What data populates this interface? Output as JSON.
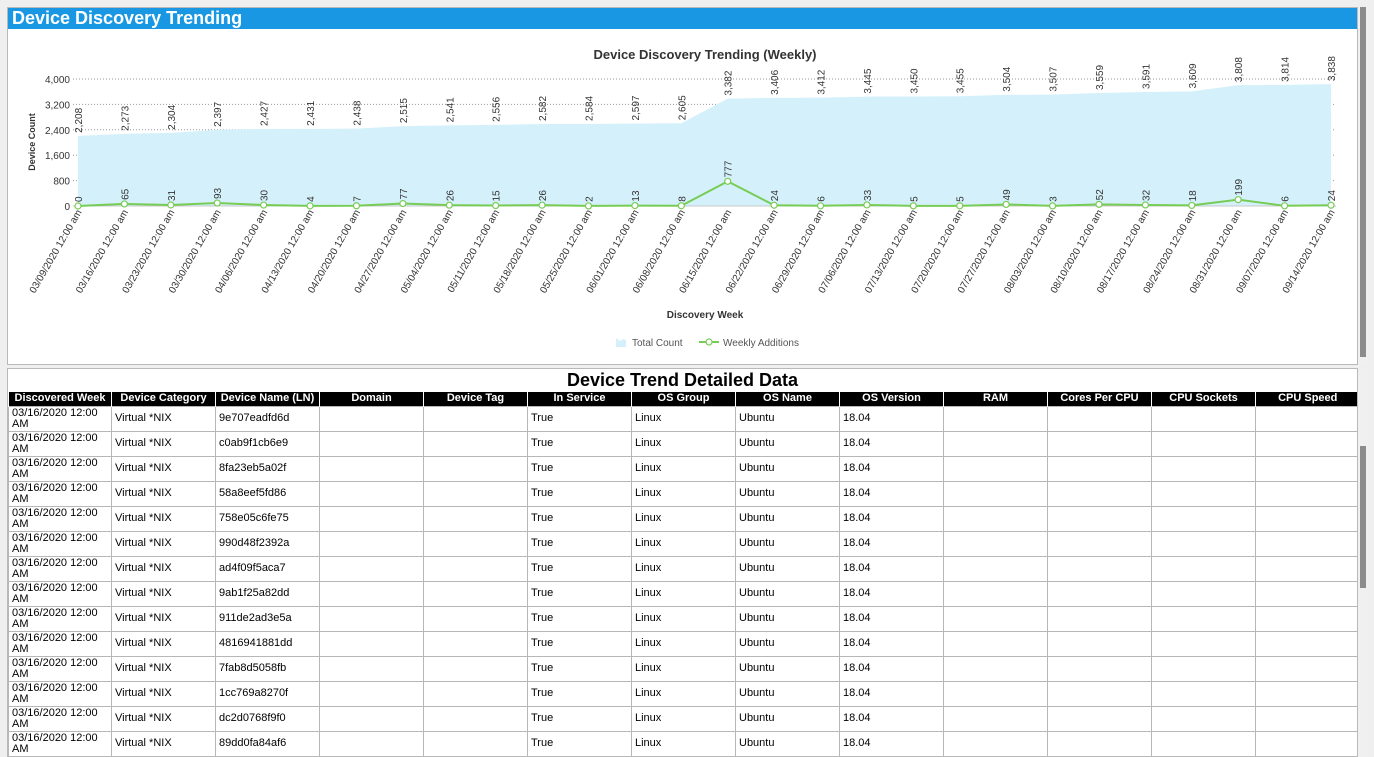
{
  "header": {
    "title": "Device Discovery Trending"
  },
  "chart_data": {
    "type": "area",
    "title": "Device Discovery Trending (Weekly)",
    "xlabel": "Discovery Week",
    "ylabel": "Device Count",
    "ylim": [
      0,
      4000
    ],
    "yticks": [
      "0",
      "800",
      "1,600",
      "2,400",
      "3,200",
      "4,000"
    ],
    "grid": "horizontal dotted",
    "legend_placement": "bottom-center",
    "categories": [
      "03/09/2020 12:00 am",
      "03/16/2020 12:00 am",
      "03/23/2020 12:00 am",
      "03/30/2020 12:00 am",
      "04/06/2020 12:00 am",
      "04/13/2020 12:00 am",
      "04/20/2020 12:00 am",
      "04/27/2020 12:00 am",
      "05/04/2020 12:00 am",
      "05/11/2020 12:00 am",
      "05/18/2020 12:00 am",
      "05/25/2020 12:00 am",
      "06/01/2020 12:00 am",
      "06/08/2020 12:00 am",
      "06/15/2020 12:00 am",
      "06/22/2020 12:00 am",
      "06/29/2020 12:00 am",
      "07/06/2020 12:00 am",
      "07/13/2020 12:00 am",
      "07/20/2020 12:00 am",
      "07/27/2020 12:00 am",
      "08/03/2020 12:00 am",
      "08/10/2020 12:00 am",
      "08/17/2020 12:00 am",
      "08/24/2020 12:00 am",
      "08/31/2020 12:00 am",
      "09/07/2020 12:00 am",
      "09/14/2020 12:00 am"
    ],
    "series": [
      {
        "name": "Total Count",
        "type": "area",
        "color": "#d4f1fb",
        "values": [
          2208,
          2273,
          2304,
          2397,
          2427,
          2431,
          2438,
          2515,
          2541,
          2556,
          2582,
          2584,
          2597,
          2605,
          3382,
          3406,
          3412,
          3445,
          3450,
          3455,
          3504,
          3507,
          3559,
          3591,
          3609,
          3808,
          3814,
          3838
        ],
        "labels": [
          "2,208",
          "2,273",
          "2,304",
          "2,397",
          "2,427",
          "2,431",
          "2,438",
          "2,515",
          "2,541",
          "2,556",
          "2,582",
          "2,584",
          "2,597",
          "2,605",
          "3,382",
          "3,406",
          "3,412",
          "3,445",
          "3,450",
          "3,455",
          "3,504",
          "3,507",
          "3,559",
          "3,591",
          "3,609",
          "3,808",
          "3,814",
          "3,838"
        ]
      },
      {
        "name": "Weekly Additions",
        "type": "line",
        "color": "#77cc55",
        "values": [
          0,
          65,
          31,
          93,
          30,
          4,
          7,
          77,
          26,
          15,
          26,
          2,
          13,
          8,
          777,
          24,
          6,
          33,
          5,
          5,
          49,
          3,
          52,
          32,
          18,
          199,
          6,
          24
        ],
        "labels": [
          "0",
          "65",
          "31",
          "93",
          "30",
          "4",
          "7",
          "77",
          "26",
          "15",
          "26",
          "2",
          "13",
          "8",
          "777",
          "24",
          "6",
          "33",
          "5",
          "5",
          "49",
          "3",
          "52",
          "32",
          "18",
          "199",
          "6",
          "24"
        ]
      }
    ]
  },
  "table": {
    "title": "Device Trend Detailed Data",
    "columns": [
      "Discovered Week",
      "Device Category",
      "Device Name (LN)",
      "Domain",
      "Device Tag",
      "In Service",
      "OS Group",
      "OS Name",
      "OS Version",
      "RAM",
      "Cores Per CPU",
      "CPU Sockets",
      "CPU Speed"
    ],
    "rows": [
      [
        "03/16/2020 12:00 AM",
        "Virtual *NIX",
        "9e707eadfd6d",
        "",
        "",
        "True",
        "Linux",
        "Ubuntu",
        "18.04",
        "",
        "",
        "",
        ""
      ],
      [
        "03/16/2020 12:00 AM",
        "Virtual *NIX",
        "c0ab9f1cb6e9",
        "",
        "",
        "True",
        "Linux",
        "Ubuntu",
        "18.04",
        "",
        "",
        "",
        ""
      ],
      [
        "03/16/2020 12:00 AM",
        "Virtual *NIX",
        "8fa23eb5a02f",
        "",
        "",
        "True",
        "Linux",
        "Ubuntu",
        "18.04",
        "",
        "",
        "",
        ""
      ],
      [
        "03/16/2020 12:00 AM",
        "Virtual *NIX",
        "58a8eef5fd86",
        "",
        "",
        "True",
        "Linux",
        "Ubuntu",
        "18.04",
        "",
        "",
        "",
        ""
      ],
      [
        "03/16/2020 12:00 AM",
        "Virtual *NIX",
        "758e05c6fe75",
        "",
        "",
        "True",
        "Linux",
        "Ubuntu",
        "18.04",
        "",
        "",
        "",
        ""
      ],
      [
        "03/16/2020 12:00 AM",
        "Virtual *NIX",
        "990d48f2392a",
        "",
        "",
        "True",
        "Linux",
        "Ubuntu",
        "18.04",
        "",
        "",
        "",
        ""
      ],
      [
        "03/16/2020 12:00 AM",
        "Virtual *NIX",
        "ad4f09f5aca7",
        "",
        "",
        "True",
        "Linux",
        "Ubuntu",
        "18.04",
        "",
        "",
        "",
        ""
      ],
      [
        "03/16/2020 12:00 AM",
        "Virtual *NIX",
        "9ab1f25a82dd",
        "",
        "",
        "True",
        "Linux",
        "Ubuntu",
        "18.04",
        "",
        "",
        "",
        ""
      ],
      [
        "03/16/2020 12:00 AM",
        "Virtual *NIX",
        "911de2ad3e5a",
        "",
        "",
        "True",
        "Linux",
        "Ubuntu",
        "18.04",
        "",
        "",
        "",
        ""
      ],
      [
        "03/16/2020 12:00 AM",
        "Virtual *NIX",
        "4816941881dd",
        "",
        "",
        "True",
        "Linux",
        "Ubuntu",
        "18.04",
        "",
        "",
        "",
        ""
      ],
      [
        "03/16/2020 12:00 AM",
        "Virtual *NIX",
        "7fab8d5058fb",
        "",
        "",
        "True",
        "Linux",
        "Ubuntu",
        "18.04",
        "",
        "",
        "",
        ""
      ],
      [
        "03/16/2020 12:00 AM",
        "Virtual *NIX",
        "1cc769a8270f",
        "",
        "",
        "True",
        "Linux",
        "Ubuntu",
        "18.04",
        "",
        "",
        "",
        ""
      ],
      [
        "03/16/2020 12:00 AM",
        "Virtual *NIX",
        "dc2d0768f9f0",
        "",
        "",
        "True",
        "Linux",
        "Ubuntu",
        "18.04",
        "",
        "",
        "",
        ""
      ],
      [
        "03/16/2020 12:00 AM",
        "Virtual *NIX",
        "89dd0fa84af6",
        "",
        "",
        "True",
        "Linux",
        "Ubuntu",
        "18.04",
        "",
        "",
        "",
        ""
      ]
    ]
  }
}
